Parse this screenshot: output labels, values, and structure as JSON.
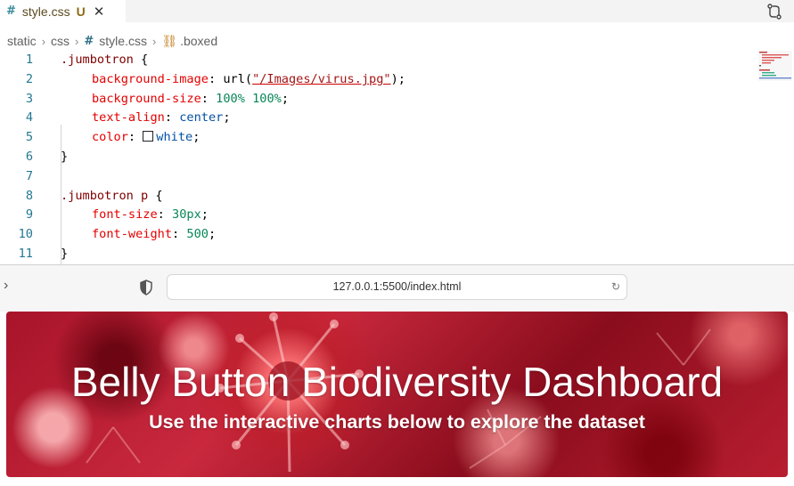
{
  "editor": {
    "tab": {
      "icon": "css-hash-icon",
      "filename": "style.css",
      "status": "U"
    },
    "breadcrumbs": [
      "static",
      "css",
      "style.css",
      ".boxed"
    ],
    "lines": [
      {
        "n": "1",
        "code": ".jumbotron {"
      },
      {
        "n": "2",
        "code": "background-image: url(\"/Images/virus.jpg\");"
      },
      {
        "n": "3",
        "code": "background-size: 100% 100%;"
      },
      {
        "n": "4",
        "code": "text-align: center;"
      },
      {
        "n": "5",
        "code": "color: white;"
      },
      {
        "n": "6",
        "code": "}"
      },
      {
        "n": "7",
        "code": ""
      },
      {
        "n": "8",
        "code": ".jumbotron p {"
      },
      {
        "n": "9",
        "code": "font-size: 30px;"
      },
      {
        "n": "10",
        "code": "font-weight: 500;"
      },
      {
        "n": "11",
        "code": "}"
      }
    ],
    "tokens": {
      "l1_sel": ".jumbotron",
      "l1_brace": " {",
      "l2_prop": "background-image",
      "l2_colon": ": url(",
      "l2_str": "\"/Images/virus.jpg\"",
      "l2_end": ");",
      "l3_prop": "background-size",
      "l3_colon": ": ",
      "l3_v1": "100%",
      "l3_v2": "100%",
      "l3_end": ";",
      "l4_prop": "text-align",
      "l4_colon": ": ",
      "l4_val": "center",
      "l4_end": ";",
      "l5_prop": "color",
      "l5_colon": ": ",
      "l5_val": "white",
      "l5_end": ";",
      "l6": "}",
      "l8_sel": ".jumbotron p",
      "l8_brace": " {",
      "l9_prop": "font-size",
      "l9_colon": ": ",
      "l9_val": "30px",
      "l9_end": ";",
      "l10_prop": "font-weight",
      "l10_colon": ": ",
      "l10_val": "500",
      "l10_end": ";",
      "l11": "}"
    }
  },
  "browser": {
    "url": "127.0.0.1:5500/index.html"
  },
  "page": {
    "title": "Belly Button Biodiversity Dashboard",
    "subtitle": "Use the interactive charts below to explore the dataset"
  },
  "colors": {
    "keyword_red": "#e50000",
    "string": "#a31515",
    "number": "#098658",
    "value": "#0451a5",
    "line_number": "#237893",
    "jumbotron_red": "#b81e30"
  }
}
